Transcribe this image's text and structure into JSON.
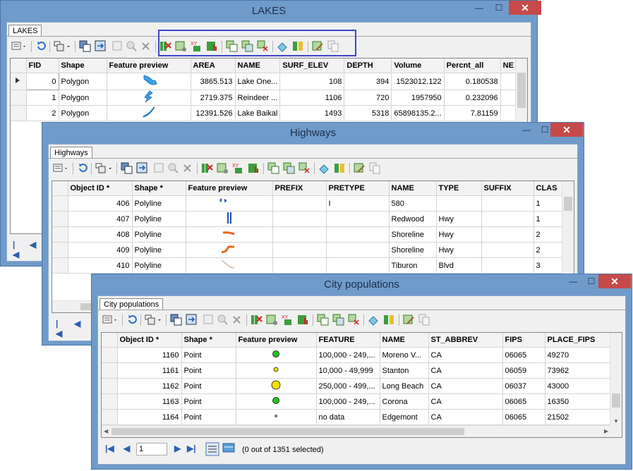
{
  "lakes": {
    "title": "LAKES",
    "tab": "LAKES",
    "columns": [
      "FID",
      "Shape",
      "Feature preview",
      "AREA",
      "NAME",
      "SURF_ELEV",
      "DEPTH",
      "Volume",
      "Percnt_all",
      "NE"
    ],
    "rows": [
      [
        "0",
        "Polygon",
        "",
        "3865.513",
        "Lake One...",
        "108",
        "394",
        "1523012.122",
        "0.180538"
      ],
      [
        "1",
        "Polygon",
        "",
        "2719.375",
        "Reindeer ...",
        "1106",
        "720",
        "1957950",
        "0.232096"
      ],
      [
        "2",
        "Polygon",
        "",
        "12391.526",
        "Lake Baikal",
        "1493",
        "5318",
        "65898135.2...",
        "7.81159"
      ]
    ]
  },
  "highways": {
    "title": "Highways",
    "tab": "Highways",
    "columns": [
      "Object ID *",
      "Shape *",
      "Feature preview",
      "PREFIX",
      "PRETYPE",
      "NAME",
      "TYPE",
      "SUFFIX",
      "CLAS"
    ],
    "rows": [
      [
        "406",
        "Polyline",
        "",
        "",
        "I",
        "580",
        "",
        "",
        "1"
      ],
      [
        "407",
        "Polyline",
        "",
        "",
        "",
        "Redwood",
        "Hwy",
        "",
        "1"
      ],
      [
        "408",
        "Polyline",
        "",
        "",
        "",
        "Shoreline",
        "Hwy",
        "",
        "2"
      ],
      [
        "409",
        "Polyline",
        "",
        "",
        "",
        "Shoreline",
        "Hwy",
        "",
        "2"
      ],
      [
        "410",
        "Polyline",
        "",
        "",
        "",
        "Tiburon",
        "Blvd",
        "",
        "3"
      ]
    ]
  },
  "cities": {
    "title": "City populations",
    "tab": "City populations",
    "columns": [
      "Object ID *",
      "Shape *",
      "Feature preview",
      "FEATURE",
      "NAME",
      "ST_ABBREV",
      "FIPS",
      "PLACE_FIPS"
    ],
    "rows": [
      [
        "1160",
        "Point",
        "",
        "100,000 - 249,...",
        "Moreno V...",
        "CA",
        "06065",
        "49270"
      ],
      [
        "1161",
        "Point",
        "",
        "10,000 - 49,999",
        "Stanton",
        "CA",
        "06059",
        "73962"
      ],
      [
        "1162",
        "Point",
        "",
        "250,000 - 499,...",
        "Long Beach",
        "CA",
        "06037",
        "43000"
      ],
      [
        "1163",
        "Point",
        "",
        "100,000 - 249,...",
        "Corona",
        "CA",
        "06065",
        "16350"
      ],
      [
        "1164",
        "Point",
        "",
        "no data",
        "Edgemont",
        "CA",
        "06065",
        "21502"
      ]
    ],
    "nav_page": "1",
    "status": "(0 out of 1351 selected)"
  },
  "window_buttons": {
    "minimize": "—",
    "maximize": "☐",
    "close": "✕"
  },
  "colors": {
    "window_frame": "#6f9bcb",
    "close_button": "#c74949",
    "highlight_box": "#3c46c8",
    "point_green": "#22c322",
    "point_yellow": "#f0e000",
    "line_orange": "#e8651a"
  }
}
